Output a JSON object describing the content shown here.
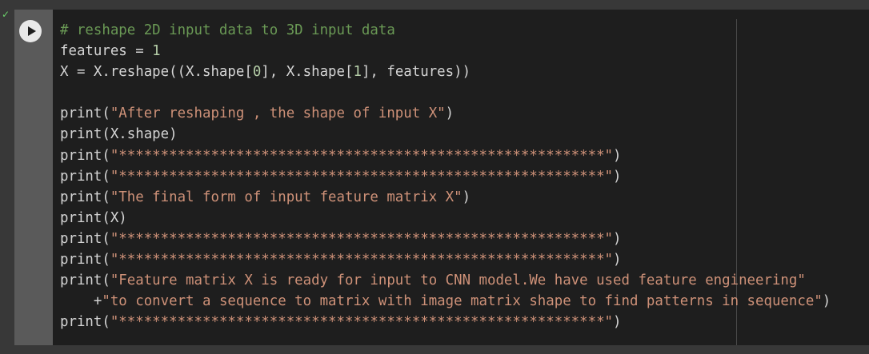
{
  "cell": {
    "execution_count": "",
    "status_icon": "check-icon",
    "run_icon": "play-icon",
    "lines": [
      [
        {
          "t": "comment",
          "v": "# reshape 2D input data to 3D input data"
        }
      ],
      [
        {
          "t": "plain",
          "v": "features = "
        },
        {
          "t": "num",
          "v": "1"
        }
      ],
      [
        {
          "t": "plain",
          "v": "X = X.reshape((X.shape["
        },
        {
          "t": "num",
          "v": "0"
        },
        {
          "t": "plain",
          "v": "], X.shape["
        },
        {
          "t": "num",
          "v": "1"
        },
        {
          "t": "plain",
          "v": "], features))"
        }
      ],
      [
        {
          "t": "plain",
          "v": ""
        }
      ],
      [
        {
          "t": "plain",
          "v": "print("
        },
        {
          "t": "str",
          "v": "\"After reshaping , the shape of input X\""
        },
        {
          "t": "plain",
          "v": ")"
        }
      ],
      [
        {
          "t": "plain",
          "v": "print(X.shape)"
        }
      ],
      [
        {
          "t": "plain",
          "v": "print("
        },
        {
          "t": "str",
          "v": "\"**********************************************************\""
        },
        {
          "t": "plain",
          "v": ")"
        }
      ],
      [
        {
          "t": "plain",
          "v": "print("
        },
        {
          "t": "str",
          "v": "\"**********************************************************\""
        },
        {
          "t": "plain",
          "v": ")"
        }
      ],
      [
        {
          "t": "plain",
          "v": "print("
        },
        {
          "t": "str",
          "v": "\"The final form of input feature matrix X\""
        },
        {
          "t": "plain",
          "v": ")"
        }
      ],
      [
        {
          "t": "plain",
          "v": "print(X)"
        }
      ],
      [
        {
          "t": "plain",
          "v": "print("
        },
        {
          "t": "str",
          "v": "\"**********************************************************\""
        },
        {
          "t": "plain",
          "v": ")"
        }
      ],
      [
        {
          "t": "plain",
          "v": "print("
        },
        {
          "t": "str",
          "v": "\"**********************************************************\""
        },
        {
          "t": "plain",
          "v": ")"
        }
      ],
      [
        {
          "t": "plain",
          "v": "print("
        },
        {
          "t": "str",
          "v": "\"Feature matrix X is ready for input to CNN model.We have used feature engineering\""
        }
      ],
      [
        {
          "t": "plain",
          "v": "    +"
        },
        {
          "t": "str",
          "v": "\"to convert a sequence to matrix with image matrix shape to find patterns in sequence\""
        },
        {
          "t": "plain",
          "v": ")"
        }
      ],
      [
        {
          "t": "plain",
          "v": "print("
        },
        {
          "t": "str",
          "v": "\"**********************************************************\""
        },
        {
          "t": "plain",
          "v": ")"
        }
      ]
    ]
  },
  "colors": {
    "background": "#1e1e1e",
    "comment": "#6a9955",
    "number": "#b5cea8",
    "string": "#ce9178",
    "text": "#d4d4d4"
  }
}
